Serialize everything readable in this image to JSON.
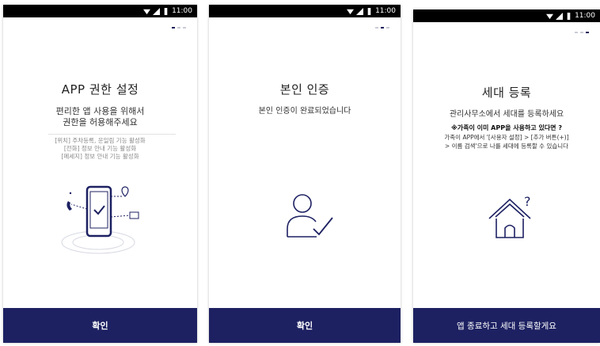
{
  "status": {
    "time": "11:00"
  },
  "screens": [
    {
      "title": "APP 권한 설정",
      "subtitle": [
        "편리한 앱 사용을 위해서",
        "권한을 허용해주세요"
      ],
      "permissions": [
        "[위치] 주차등록, 운일림 기능 활성화",
        "[전화] 정보 안내 기능 활성화",
        "[메세지] 정보 안내 기능 활성화"
      ],
      "button": "확인",
      "illustration": "phone-permission-illustration"
    },
    {
      "title": "본인 인증",
      "subtitle": "본인 인증이 완료되었습니다",
      "button": "확인",
      "illustration": "user-verified-icon"
    },
    {
      "title": "세대 등록",
      "subtitle": "관리사무소에서 세대를 등록하세요",
      "note": "※가족이 이미 APP을 사용하고 있다면 ?",
      "detail": [
        "가족이 APP에서 '[사용자 설정] > [추가 버튼(+)]",
        "> 이름 검색'으로 나를 세대에 등록할 수 있습니다"
      ],
      "button": "앱 종료하고 세대 등록할게요",
      "illustration": "house-question-icon"
    }
  ],
  "colors": {
    "primary": "#1d2162",
    "dot_inactive": "#c9ccd6"
  }
}
